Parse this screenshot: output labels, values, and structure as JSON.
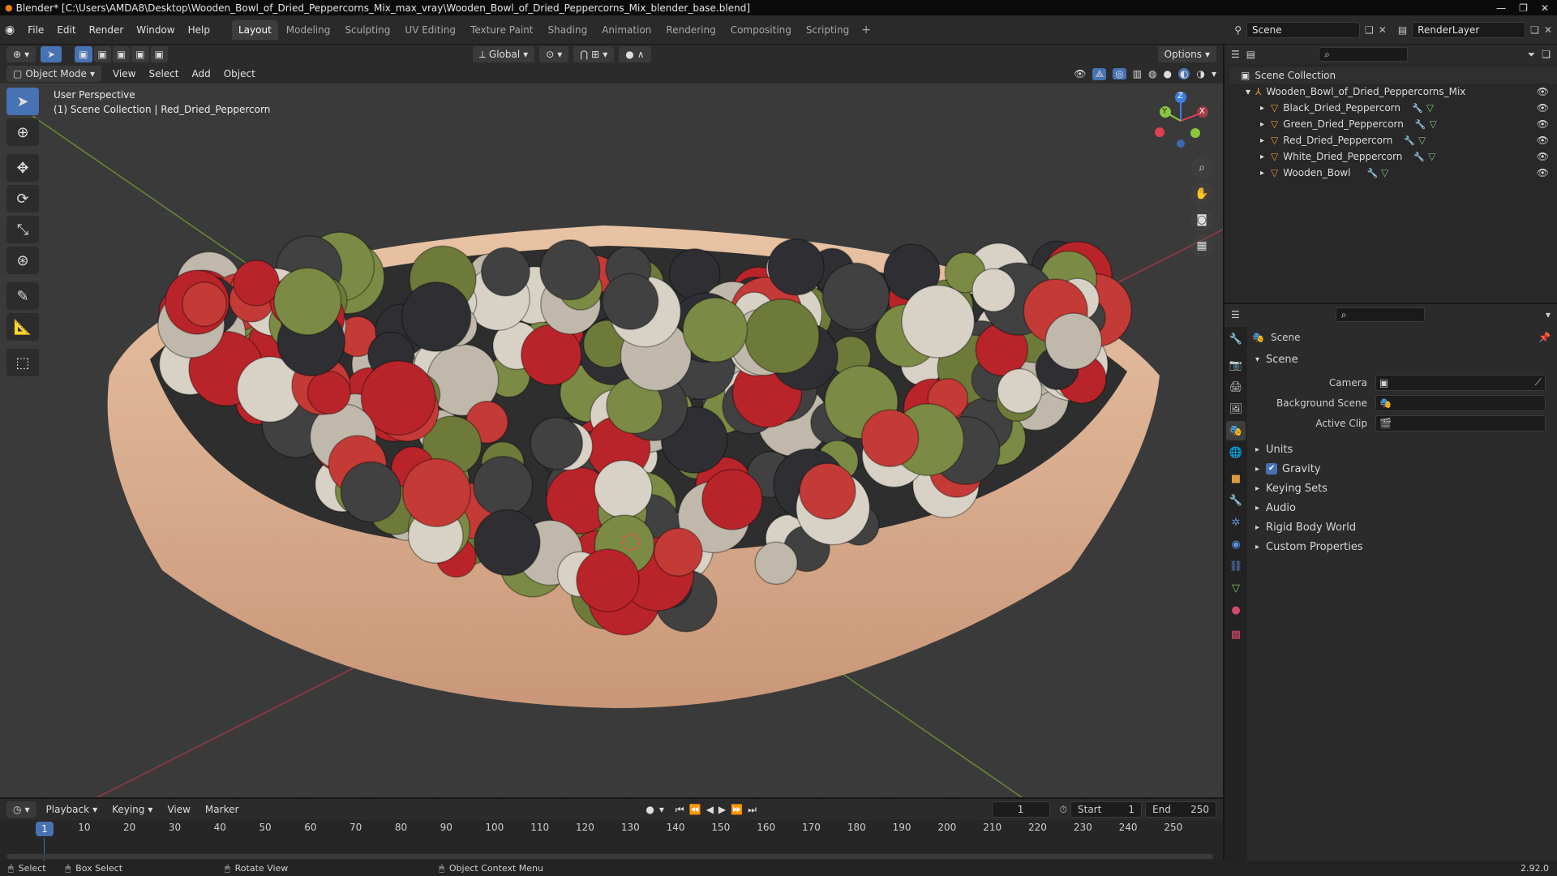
{
  "window": {
    "title": "Blender* [C:\\Users\\AMDA8\\Desktop\\Wooden_Bowl_of_Dried_Peppercorns_Mix_max_vray\\Wooden_Bowl_of_Dried_Peppercorns_Mix_blender_base.blend]",
    "min_glyph": "—",
    "max_glyph": "❐",
    "close_glyph": "✕"
  },
  "menu": [
    "File",
    "Edit",
    "Render",
    "Window",
    "Help"
  ],
  "workspaces": [
    "Layout",
    "Modeling",
    "Sculpting",
    "UV Editing",
    "Texture Paint",
    "Shading",
    "Animation",
    "Rendering",
    "Compositing",
    "Scripting"
  ],
  "workspace_add": "+",
  "scene_name": "Scene",
  "render_layer": "RenderLayer",
  "viewport": {
    "mode": "Object Mode",
    "menus": [
      "View",
      "Select",
      "Add",
      "Object"
    ],
    "transform_orientation": "Global",
    "options_label": "Options",
    "perspective_label": "User Perspective",
    "collection_label": "(1) Scene Collection | Red_Dried_Peppercorn",
    "gizmo_axes": {
      "x": "X",
      "y": "Y",
      "z": "Z"
    }
  },
  "outliner": {
    "root": "Scene Collection",
    "collection": "Wooden_Bowl_of_Dried_Peppercorns_Mix",
    "objects": [
      "Black_Dried_Peppercorn",
      "Green_Dried_Peppercorn",
      "Red_Dried_Peppercorn",
      "White_Dried_Peppercorn",
      "Wooden_Bowl"
    ]
  },
  "properties": {
    "header": "Scene",
    "panel": "Scene",
    "fields": {
      "camera_label": "Camera",
      "background_scene_label": "Background Scene",
      "active_clip_label": "Active Clip"
    },
    "subpanels": [
      "Units",
      "Gravity",
      "Keying Sets",
      "Audio",
      "Rigid Body World",
      "Custom Properties"
    ],
    "gravity_enabled": true
  },
  "timeline": {
    "menus": [
      "Playback",
      "Keying",
      "View",
      "Marker"
    ],
    "current_frame": "1",
    "start_label": "Start",
    "start_value": "1",
    "end_label": "End",
    "end_value": "250",
    "ticks": [
      "10",
      "20",
      "30",
      "40",
      "50",
      "60",
      "70",
      "80",
      "90",
      "100",
      "110",
      "120",
      "130",
      "140",
      "150",
      "160",
      "170",
      "180",
      "190",
      "200",
      "210",
      "220",
      "230",
      "240",
      "250"
    ],
    "playhead_label": "1"
  },
  "statusbar": {
    "select": "Select",
    "box_select": "Box Select",
    "rotate_view": "Rotate View",
    "context_menu": "Object Context Menu",
    "version": "2.92.0"
  },
  "colors": {
    "accent": "#4772b3",
    "object_icon": "#e09a3e",
    "mesh_icon": "#7ec36a",
    "x_axis": "#e04050",
    "y_axis": "#8cc63e",
    "z_axis": "#3a7fe0"
  }
}
